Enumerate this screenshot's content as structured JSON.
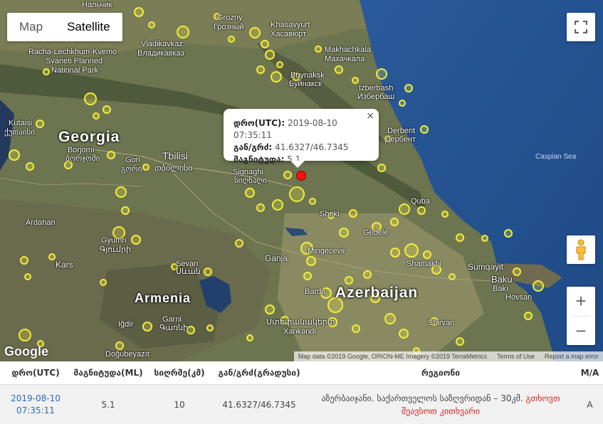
{
  "map": {
    "maptype": {
      "map_label": "Map",
      "satellite_label": "Satellite"
    },
    "countries": {
      "georgia": "Georgia",
      "armenia": "Armenia",
      "azerbaijan": "Azerbaijan"
    },
    "places": {
      "grozny": "Grozny",
      "grozny2": "Грозный",
      "khasavyurt": "Khasavyurt",
      "khasavyurt2": "Хасавюрт",
      "vladikavkaz": "Vladikavkaz",
      "vladikavkaz2": "Владикавказ",
      "makhachkala": "Makhachkala",
      "makhachkala2": "Махачкала",
      "racha1": "Racha-Lechkhum-Kvemo",
      "racha2": "Svaneti Planned",
      "racha3": "National Park",
      "buynaksk": "Buynaksk",
      "buynaksk2": "Буйнакск",
      "izberbash": "Izberbash",
      "izberbash2": "Избербаш",
      "kutaisi": "Kutaisi",
      "kutaisi2": "ქუთაისი",
      "derbent": "Derbent",
      "derbent2": "Дербент",
      "borjomi": "Borjomi",
      "borjomi2": "ბორჯომი",
      "gori": "Gori",
      "gori2": "გორი",
      "tbilisi": "Tbilisi",
      "tbilisi2": "თბილისი",
      "signaghi": "Signaghi",
      "signaghi2": "სიღნაღი",
      "ardahan": "Ardahan",
      "sheki": "Sheki",
      "gebele": "Gebele",
      "quba": "Quba",
      "gyumri": "Gyumri",
      "gyumri2": "Գյումրի",
      "mingecevir": "Mingecevir",
      "kars": "Kars",
      "sevan": "Sevan",
      "sevan2": "Սևան",
      "ganja": "Ganja",
      "shamakhi": "Shamakhi",
      "sumqayit": "Sumqayit",
      "baku": "Baku",
      "baku2": "Bakı",
      "hovsan": "Hovsan",
      "barda": "Barda",
      "garni": "Garni",
      "garni2": "Գառնի",
      "igdir": "Iğdir",
      "stepanakert": "Ստեփանակերտ",
      "xankendi": "Xankəndi",
      "shirvan": "Shirvan",
      "dogubeyazit": "Doğubeyazıt",
      "nalchik": "Нальчик"
    },
    "sea": "Caspian Sea",
    "info": {
      "date_label": "დრო(UTC):",
      "date_value": "2019-08-10 07:35:11",
      "coord_label": "გან/გრძ:",
      "coord_value": "41.6327/46.7345",
      "mag_label": "მაგნიტუდა:",
      "mag_value": "5.1",
      "close": "×"
    },
    "google_logo": "Google",
    "attribution": {
      "data": "Map data ©2019 Google, ORION-ME Imagery ©2019 TerraMetrics",
      "terms": "Terms of Use",
      "report": "Report a map error"
    },
    "controls": {
      "zoom_in": "+",
      "zoom_out": "−"
    }
  },
  "table": {
    "headers": {
      "date": "დრო(UTC)",
      "magnitude": "მაგნიტუდა(ML)",
      "depth": "სიღრმე(კმ)",
      "coords": "გან/გრძ(გრადუსი)",
      "region": "რეგიონი",
      "ma": "M/A"
    },
    "row": {
      "date_line1": "2019-08-10",
      "date_line2": "07:35:11",
      "magnitude": "5.1",
      "depth": "10",
      "coords": "41.6327/46.7345",
      "region": "აზერბაიჯანი. საქართველოს საზღვრიდან – 30კმ.",
      "region_more_1": "გთხოვთ",
      "region_more_2": "შეავსოთ კითხვარი",
      "ma": "A"
    }
  }
}
